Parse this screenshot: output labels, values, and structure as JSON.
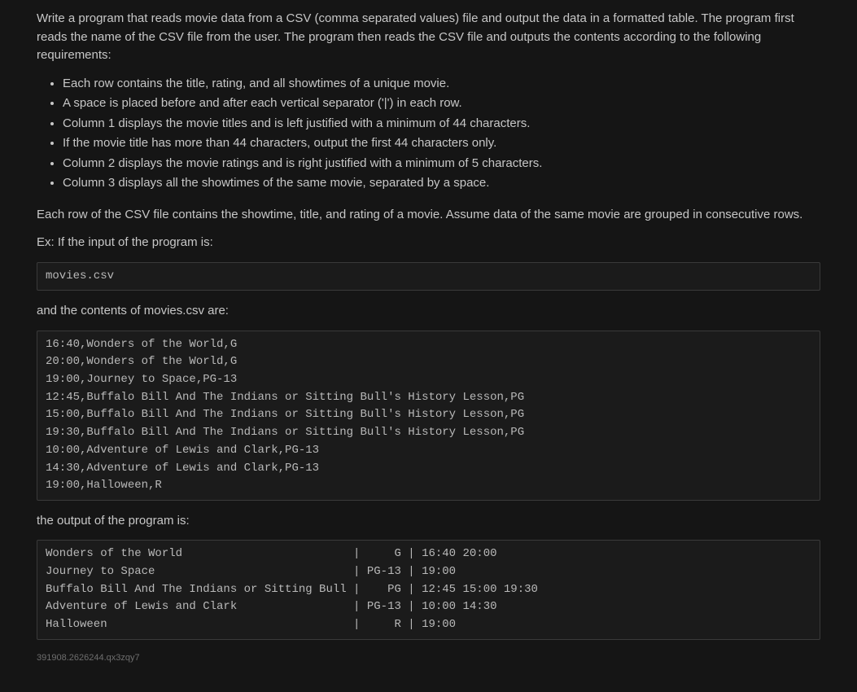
{
  "intro": "Write a program that reads movie data from a CSV (comma separated values) file and output the data in a formatted table. The program first reads the name of the CSV file from the user. The program then reads the CSV file and outputs the contents according to the following requirements:",
  "bullets": [
    "Each row contains the title, rating, and all showtimes of a unique movie.",
    "A space is placed before and after each vertical separator ('|') in each row.",
    "Column 1 displays the movie titles and is left justified with a minimum of 44 characters.",
    "If the movie title has more than 44 characters, output the first 44 characters only.",
    "Column 2 displays the movie ratings and is right justified with a minimum of 5 characters.",
    "Column 3 displays all the showtimes of the same movie, separated by a space."
  ],
  "para2": "Each row of the CSV file contains the showtime, title, and rating of a movie. Assume data of the same movie are grouped in consecutive rows.",
  "exLabel": "Ex: If the input of the program is:",
  "inputBox": "movies.csv",
  "contentsLabel": "and the contents of movies.csv are:",
  "csvBox": "16:40,Wonders of the World,G\n20:00,Wonders of the World,G\n19:00,Journey to Space,PG-13\n12:45,Buffalo Bill And The Indians or Sitting Bull's History Lesson,PG\n15:00,Buffalo Bill And The Indians or Sitting Bull's History Lesson,PG\n19:30,Buffalo Bill And The Indians or Sitting Bull's History Lesson,PG\n10:00,Adventure of Lewis and Clark,PG-13\n14:30,Adventure of Lewis and Clark,PG-13\n19:00,Halloween,R",
  "outputLabel": "the output of the program is:",
  "outputBox": "Wonders of the World                         |     G | 16:40 20:00\nJourney to Space                             | PG-13 | 19:00\nBuffalo Bill And The Indians or Sitting Bull |    PG | 12:45 15:00 19:30\nAdventure of Lewis and Clark                 | PG-13 | 10:00 14:30\nHalloween                                    |     R | 19:00",
  "footerId": "391908.2626244.qx3zqy7"
}
